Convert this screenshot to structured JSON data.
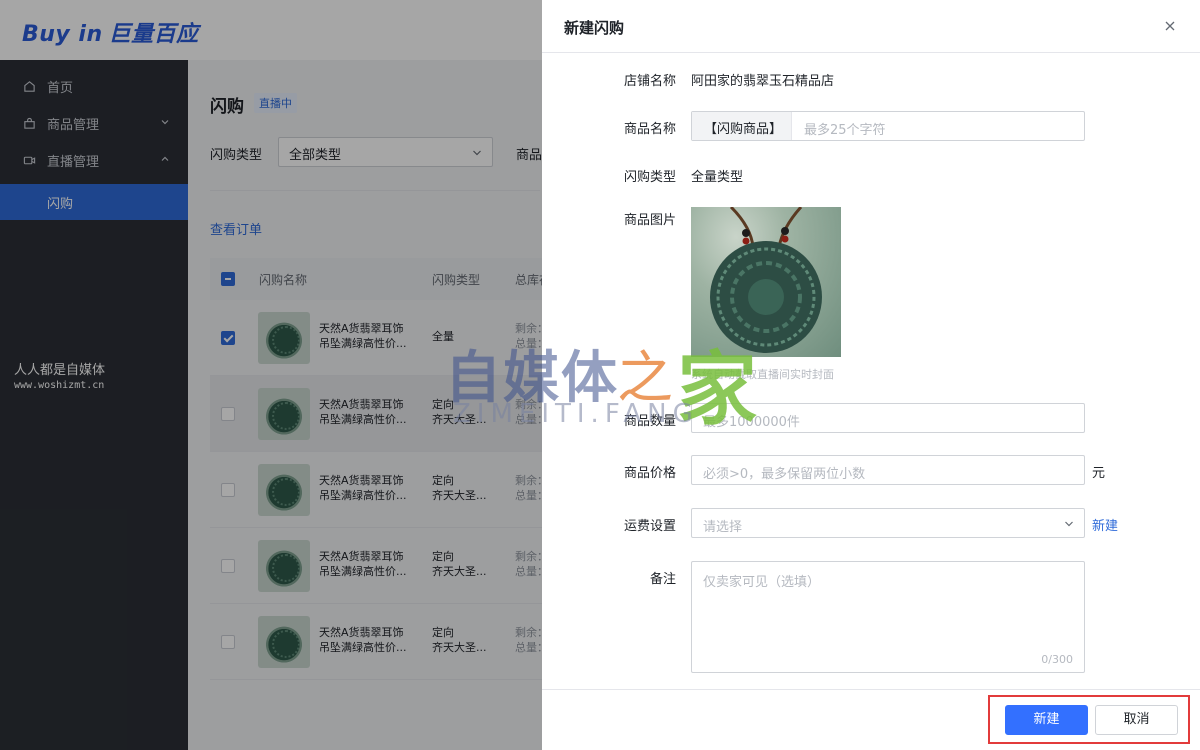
{
  "app": {
    "logo_en": "Buy in",
    "logo_cn": "巨量百应"
  },
  "sidebar": {
    "items": [
      {
        "label": "首页",
        "icon": "home-icon"
      },
      {
        "label": "商品管理",
        "icon": "bag-icon"
      },
      {
        "label": "直播管理",
        "icon": "live-icon"
      },
      {
        "label": "闪购",
        "icon": ""
      }
    ],
    "watermark_line1": "人人都是自媒体",
    "watermark_line2": "www.woshizmt.cn"
  },
  "page": {
    "title": "闪购",
    "live_tag": "直播中",
    "filter_label": "闪购类型",
    "filter_value": "全部类型",
    "filter_label2": "商品",
    "orders_link": "查看订单",
    "columns": [
      "闪购名称",
      "闪购类型",
      "总库存"
    ],
    "rows": [
      {
        "name1": "天然A货翡翠耳饰",
        "name2": "吊坠满绿高性价...",
        "type1": "全量",
        "type2": "",
        "stock1": "剩余：",
        "stock2": "总量："
      },
      {
        "name1": "天然A货翡翠耳饰",
        "name2": "吊坠满绿高性价...",
        "type1": "定向",
        "type2": "齐天大圣...",
        "stock1": "剩余：",
        "stock2": "总量："
      },
      {
        "name1": "天然A货翡翠耳饰",
        "name2": "吊坠满绿高性价...",
        "type1": "定向",
        "type2": "齐天大圣...",
        "stock1": "剩余：",
        "stock2": "总量："
      },
      {
        "name1": "天然A货翡翠耳饰",
        "name2": "吊坠满绿高性价...",
        "type1": "定向",
        "type2": "齐天大圣...",
        "stock1": "剩余：",
        "stock2": "总量："
      },
      {
        "name1": "天然A货翡翠耳饰",
        "name2": "吊坠满绿高性价...",
        "type1": "定向",
        "type2": "齐天大圣...",
        "stock1": "剩余：",
        "stock2": "总量："
      }
    ]
  },
  "drawer": {
    "title": "新建闪购",
    "fields": {
      "shop_label": "店铺名称",
      "shop_value": "阿田家的翡翠玉石精品店",
      "product_name_label": "商品名称",
      "product_name_prefix": "【闪购商品】",
      "product_name_placeholder": "最多25个字符",
      "type_label": "闪购类型",
      "type_value": "全量类型",
      "image_label": "商品图片",
      "image_tip": "系统自动截取直播间实时封面",
      "quantity_label": "商品数量",
      "quantity_placeholder": "最多1000000件",
      "price_label": "商品价格",
      "price_placeholder": "必须>0，最多保留两位小数",
      "price_unit": "元",
      "shipping_label": "运费设置",
      "shipping_placeholder": "请选择",
      "shipping_new_link": "新建",
      "note_label": "备注",
      "note_placeholder": "仅卖家可见（选填）",
      "note_count": "0/300"
    },
    "buttons": {
      "create": "新建",
      "cancel": "取消"
    }
  },
  "watermark": {
    "cn": "自媒体",
    "zhi": "之",
    "jia": "家",
    "en": "ZIMEITI.FANG"
  },
  "colors": {
    "primary": "#3370ff",
    "sidebar_bg": "#2b2f36",
    "active_nav": "#2f6bd9",
    "highlight_border": "#e23b3b"
  }
}
